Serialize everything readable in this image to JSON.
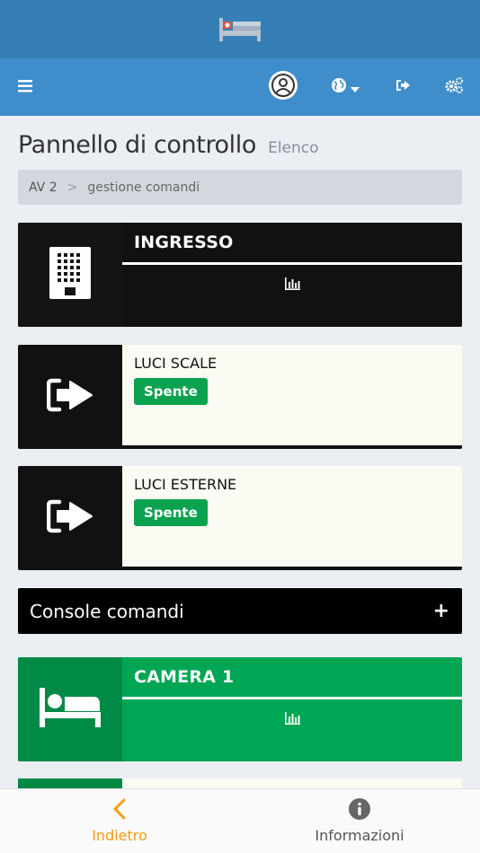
{
  "app": {
    "brand_color": "#357fb6",
    "nav_color": "#3f8ecb"
  },
  "navbar": {
    "icons": [
      "hamburger-icon",
      "user-avatar-icon",
      "globe-icon",
      "sign-out-icon",
      "gears-icon"
    ]
  },
  "header": {
    "title": "Pannello di controllo",
    "subtitle": "Elenco"
  },
  "breadcrumb": {
    "items": [
      "AV 2",
      "gestione comandi"
    ],
    "separator": ">"
  },
  "cards": [
    {
      "title": "INGRESSO",
      "type": "group",
      "icon": "building-icon",
      "color": "#111111"
    },
    {
      "title": "LUCI SCALE",
      "type": "switch",
      "icon": "sign-in-icon",
      "status": "Spente",
      "status_color": "#0aa24e"
    },
    {
      "title": "LUCI ESTERNE",
      "type": "switch",
      "icon": "sign-in-icon",
      "status": "Spente",
      "status_color": "#0aa24e"
    },
    {
      "title": "CAMERA 1",
      "type": "group",
      "icon": "bed-icon",
      "color": "#00a653"
    }
  ],
  "console": {
    "label": "Console comandi",
    "toggle": "+"
  },
  "bottom_nav": {
    "back_label": "Indietro",
    "info_label": "Informazioni",
    "active_color": "#f39c12"
  }
}
